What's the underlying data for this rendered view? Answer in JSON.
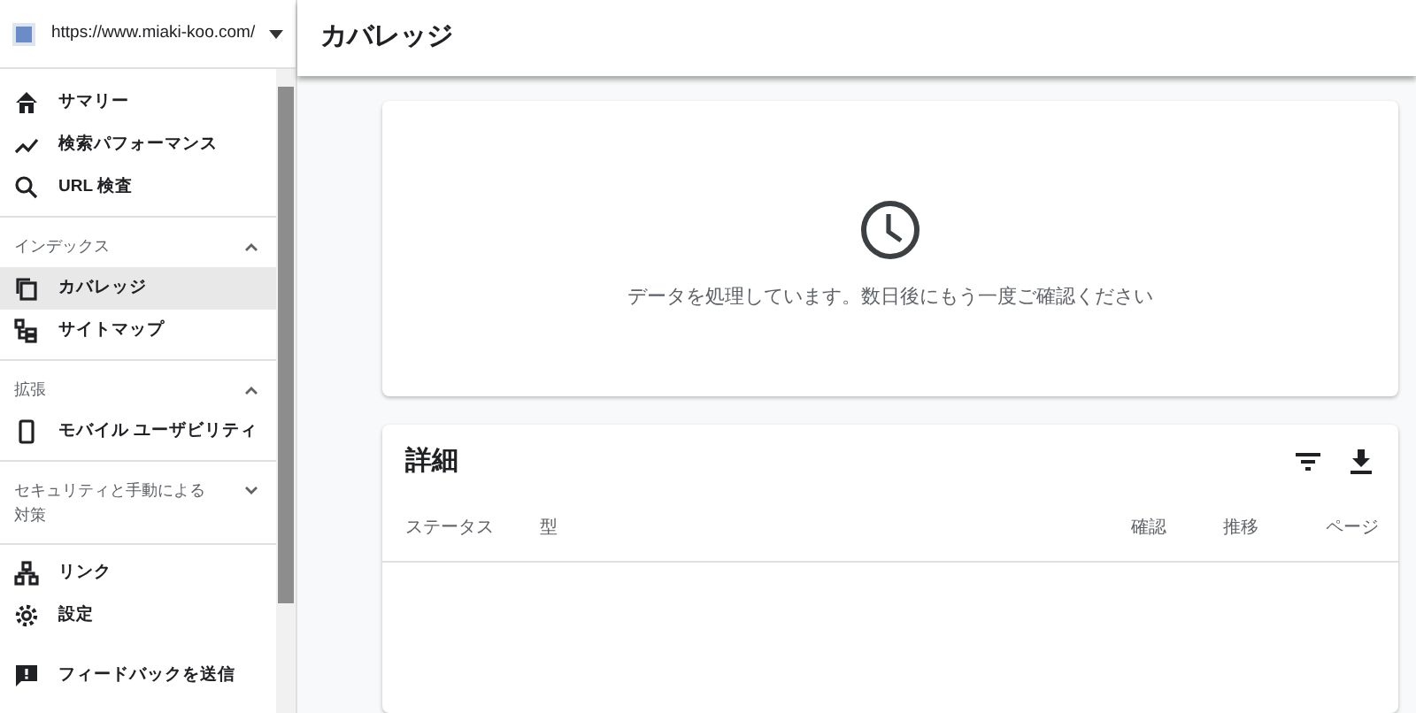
{
  "site_selector": {
    "url": "https://www.miaki-koo.com/"
  },
  "sidebar": {
    "groups": [
      {
        "items": [
          {
            "label": "サマリー",
            "selected": false
          },
          {
            "label": "検索パフォーマンス",
            "selected": false
          },
          {
            "label": "URL 検査",
            "selected": false
          }
        ]
      },
      {
        "heading": "インデックス",
        "expanded": true,
        "items": [
          {
            "label": "カバレッジ",
            "selected": true
          },
          {
            "label": "サイトマップ",
            "selected": false
          }
        ]
      },
      {
        "heading": "拡張",
        "expanded": true,
        "items": [
          {
            "label": "モバイル ユーザビリティ",
            "selected": false
          }
        ]
      },
      {
        "heading": "セキュリティと手動による対策",
        "expanded": false
      },
      {
        "items": [
          {
            "label": "リンク",
            "selected": false
          },
          {
            "label": "設定",
            "selected": false
          }
        ]
      },
      {
        "items": [
          {
            "label": "フィードバックを送信",
            "selected": false
          }
        ]
      }
    ]
  },
  "header": {
    "title": "カバレッジ"
  },
  "status_card": {
    "message": "データを処理しています。数日後にもう一度ご確認ください"
  },
  "details": {
    "title": "詳細",
    "columns": [
      "ステータス",
      "型",
      "確認",
      "推移",
      "ページ"
    ]
  }
}
